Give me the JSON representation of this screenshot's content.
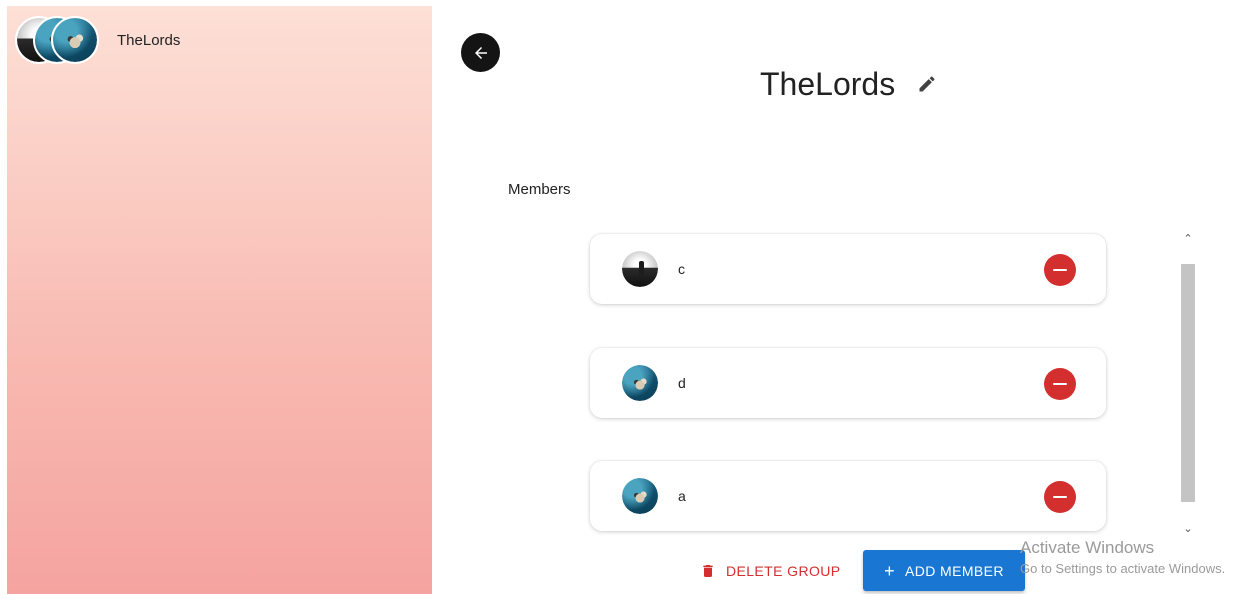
{
  "sidebar": {
    "group": {
      "name": "TheLords",
      "avatars": [
        "sky-avatar",
        "sea-otter-avatar",
        "sea-otter-avatar"
      ]
    }
  },
  "header": {
    "title": "TheLords",
    "back_icon": "arrow-left-icon",
    "edit_icon": "pencil-icon"
  },
  "members": {
    "label": "Members",
    "items": [
      {
        "name": "c",
        "avatar": "sky-avatar"
      },
      {
        "name": "d",
        "avatar": "sea-otter-avatar"
      },
      {
        "name": "a",
        "avatar": "sea-otter-avatar"
      }
    ]
  },
  "actions": {
    "delete_label": "DELETE GROUP",
    "add_label": "ADD MEMBER"
  },
  "watermark": {
    "line1": "Activate Windows",
    "line2": "Go to Settings to activate Windows."
  },
  "colors": {
    "danger": "#d32f2f",
    "primary": "#1976d2",
    "sidebar_top": "#fde0d6",
    "sidebar_bottom": "#f5a3a0"
  }
}
